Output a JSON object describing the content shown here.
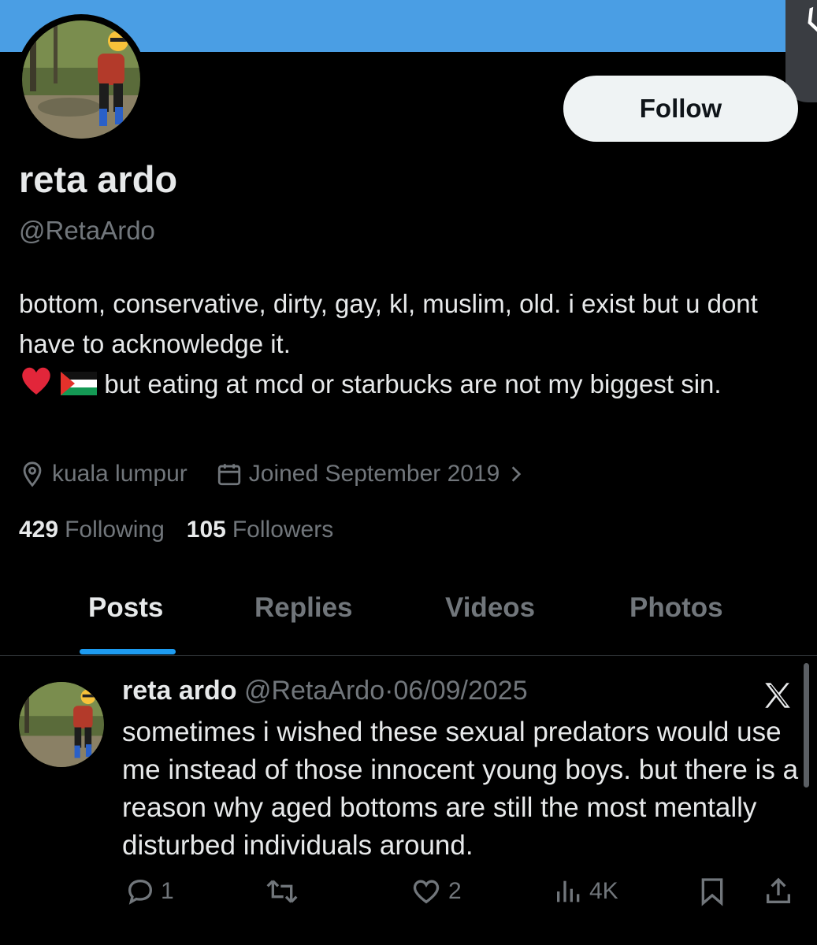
{
  "profile": {
    "name": "reta ardo",
    "handle": "@RetaArdo",
    "follow_label": "Follow",
    "bio_line1": "bottom, conservative, dirty, gay, kl, muslim, old. i exist but u dont have to acknowledge it.",
    "bio_line2": "but eating at mcd or starbucks are not my biggest sin.",
    "location": "kuala lumpur",
    "joined": "Joined September 2019",
    "following_count": "429",
    "following_label": "Following",
    "followers_count": "105",
    "followers_label": "Followers"
  },
  "tabs": [
    {
      "label": "Posts",
      "active": true
    },
    {
      "label": "Replies",
      "active": false
    },
    {
      "label": "Videos",
      "active": false
    },
    {
      "label": "Photos",
      "active": false
    }
  ],
  "post": {
    "author": "reta ardo",
    "handle": "@RetaArdo",
    "separator": "·",
    "date": "06/09/2025",
    "text": "sometimes i wished these sexual predators would use me instead of those innocent young boys. but there is a reason why aged bottoms are still the most mentally disturbed individuals around.",
    "replies": "1",
    "reposts": "",
    "likes": "2",
    "views": "4K"
  },
  "icons": {
    "back": "chevron-left-icon",
    "location": "location-pin-icon",
    "calendar": "calendar-icon",
    "chevron": "chevron-right-icon",
    "reply": "reply-icon",
    "repost": "repost-icon",
    "like": "heart-icon",
    "views": "views-icon",
    "bookmark": "bookmark-icon",
    "share": "share-icon",
    "logo": "x-logo-icon"
  },
  "colors": {
    "banner": "#4a9ee4",
    "accent": "#1d9bf0",
    "muted": "#71767b",
    "text": "#e7e9ea"
  }
}
